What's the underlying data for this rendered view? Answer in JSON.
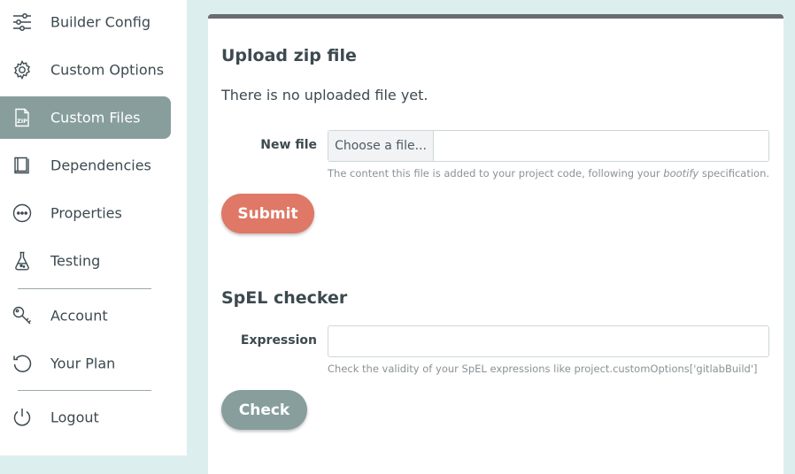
{
  "sidebar": {
    "items": [
      {
        "label": "Builder Config",
        "icon": "sliders-icon"
      },
      {
        "label": "Custom Options",
        "icon": "gear-icon"
      },
      {
        "label": "Custom Files",
        "icon": "zip-file-icon",
        "active": true
      },
      {
        "label": "Dependencies",
        "icon": "book-icon"
      },
      {
        "label": "Properties",
        "icon": "more-circle-icon"
      },
      {
        "label": "Testing",
        "icon": "flask-icon"
      },
      {
        "label": "Account",
        "icon": "key-icon"
      },
      {
        "label": "Your Plan",
        "icon": "refresh-icon"
      },
      {
        "label": "Logout",
        "icon": "power-icon"
      }
    ]
  },
  "upload": {
    "title": "Upload zip file",
    "status": "There is no uploaded file yet.",
    "field_label": "New file",
    "choose_label": "Choose a file...",
    "help_prefix": "The content this file is added to your project code, following your ",
    "help_emphasis": "bootify",
    "help_suffix": " specification.",
    "submit_label": "Submit"
  },
  "spel": {
    "title": "SpEL checker",
    "field_label": "Expression",
    "expression_value": "",
    "help": "Check the validity of your SpEL expressions like project.customOptions['gitlabBuild']",
    "check_label": "Check"
  },
  "colors": {
    "accent": "#879e9d",
    "submit": "#df7866",
    "background": "#dcefee"
  }
}
